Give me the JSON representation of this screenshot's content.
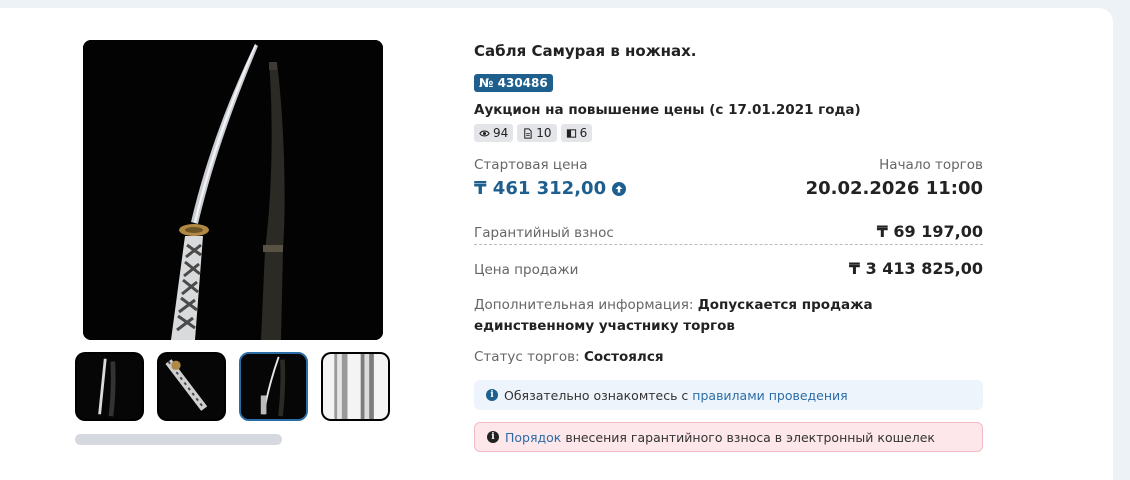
{
  "lot": {
    "title": "Сабля Самурая в ножнах.",
    "number": "№ 430486",
    "auction_type": "Аукцион на повышение цены (с 17.01.2021 года)",
    "stats": {
      "views": "94",
      "docs": "10",
      "photos": "6"
    }
  },
  "pricing": {
    "start_label": "Стартовая цена",
    "start_price": "₸ 461 312,00",
    "date_label": "Начало торгов",
    "date_value": "20.02.2026 11:00",
    "guarantee_label": "Гарантийный взнос",
    "guarantee_value": "₸ 69 197,00",
    "sale_label": "Цена продажи",
    "sale_value": "₸ 3 413 825,00"
  },
  "extra": {
    "label": "Дополнительная информация:",
    "value": "Допускается продажа единственному участнику торгов"
  },
  "status": {
    "label": "Статус торгов:",
    "value": "Состоялся"
  },
  "notices": {
    "info_prefix": "Обязательно ознакомтесь с",
    "info_link": "правилами проведения",
    "warn_link": "Порядок",
    "warn_text": "внесения гарантийного взноса в электронный кошелек"
  },
  "colors": {
    "accent": "#1e5f8f",
    "badge": "#1f5f8e",
    "link": "#2b6ca7",
    "info_bg": "#eef4fb",
    "warn_bg": "#fde7ea"
  },
  "gallery": {
    "active_thumb": 2,
    "thumb_count": 4
  }
}
